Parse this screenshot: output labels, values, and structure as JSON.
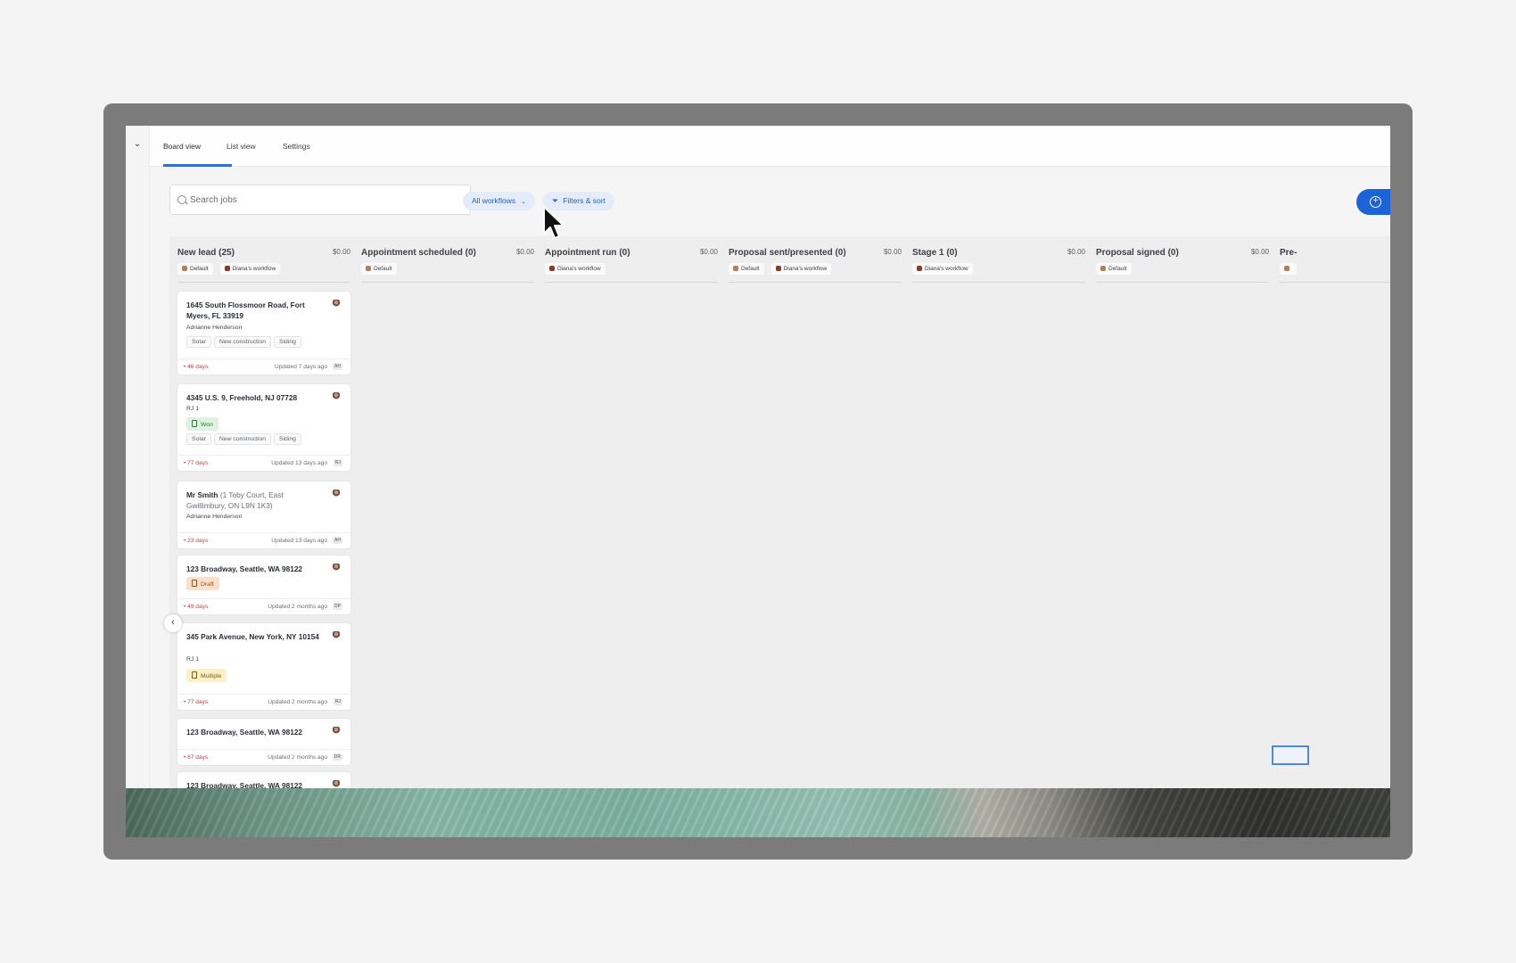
{
  "tabs": [
    {
      "label": "Board view",
      "active": true
    },
    {
      "label": "List view",
      "active": false
    },
    {
      "label": "Settings",
      "active": false
    }
  ],
  "search": {
    "placeholder": "Search jobs"
  },
  "filters": {
    "workflows_label": "All workflows",
    "filters_label": "Filters & sort"
  },
  "colors": {
    "accent": "#2f6fd8",
    "overdue": "#c0414c",
    "won": "#2b7a3a",
    "draft": "#9c4b14",
    "multiple": "#7d5b0e"
  },
  "icons": {
    "search": "search-icon",
    "filter": "filter-icon",
    "collapse": "chevron-left-icon",
    "rail": "chevron-down-icon",
    "create": "plus-circle-icon"
  },
  "columns": [
    {
      "title": "New lead (25)",
      "amount": "$0.00",
      "tags": [
        "Default",
        "Diana's workflow"
      ]
    },
    {
      "title": "Appointment scheduled (0)",
      "amount": "$0.00",
      "tags": [
        "Default"
      ]
    },
    {
      "title": "Appointment run (0)",
      "amount": "$0.00",
      "tags": [
        "Diana's workflow"
      ]
    },
    {
      "title": "Proposal sent/presented (0)",
      "amount": "$0.00",
      "tags": [
        "Default",
        "Diana's workflow"
      ]
    },
    {
      "title": "Stage 1 (0)",
      "amount": "$0.00",
      "tags": [
        "Diana's workflow"
      ]
    },
    {
      "title": "Proposal signed (0)",
      "amount": "$0.00",
      "tags": [
        "Default"
      ]
    },
    {
      "title": "Pre-",
      "amount": "",
      "tags": [
        ""
      ]
    }
  ],
  "cards": [
    {
      "address": "1645 South Flossmoor Road, Fort Myers, FL 33919",
      "person": "Adrianne Henderson",
      "chips": [
        "Solar",
        "New construction",
        "Siding"
      ],
      "days": "• 46 days",
      "updated": "Updated 7 days ago",
      "initials": "AH"
    },
    {
      "address": "4345 U.S. 9, Freehold, NJ 07728",
      "person": "RJ 1",
      "status": "Won",
      "chips": [
        "Solar",
        "New construction",
        "Siding"
      ],
      "days": "• 77 days",
      "updated": "Updated 13 days ago",
      "initials": "RJ"
    },
    {
      "address": "Mr Smith",
      "address_sub": "(1 Toby Court, East Gwillimbury, ON L9N 1K3)",
      "person": "Adrianne Henderson",
      "days": "• 23 days",
      "updated": "Updated 13 days ago",
      "initials": "AH"
    },
    {
      "address": "123 Broadway, Seattle, WA 98122",
      "status": "Draft",
      "days": "• 49 days",
      "updated": "Updated 2 months ago",
      "initials": "DP"
    },
    {
      "address": "345 Park Avenue, New York, NY 10154",
      "person": "RJ 1",
      "status": "Multiple",
      "days": "• 77 days",
      "updated": "Updated 2 months ago",
      "initials": "RJ"
    },
    {
      "address": "123 Broadway, Seattle, WA 98122",
      "days": "• 67 days",
      "updated": "Updated 2 months ago",
      "initials": "DR"
    },
    {
      "address": "123 Broadway, Seattle, WA 98122"
    }
  ]
}
